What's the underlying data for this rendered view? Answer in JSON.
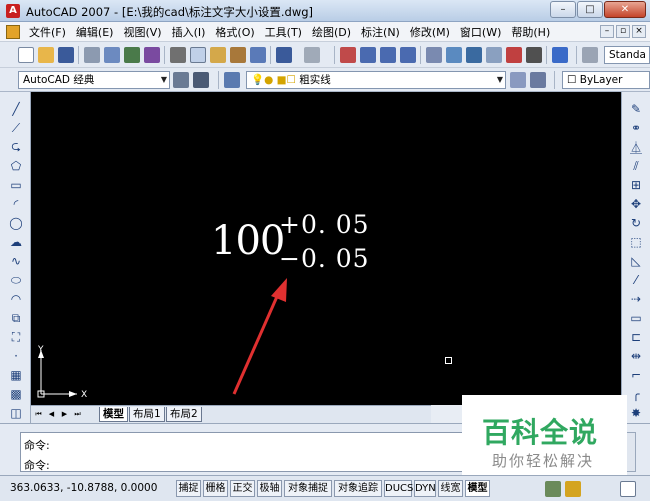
{
  "window": {
    "title": "AutoCAD 2007 - [E:\\我的cad\\标注文字大小设置.dwg]",
    "minimize_label": "–",
    "maximize_label": "□",
    "close_label": "✕"
  },
  "menu": {
    "items": [
      {
        "label": "文件(F)"
      },
      {
        "label": "编辑(E)"
      },
      {
        "label": "视图(V)"
      },
      {
        "label": "插入(I)"
      },
      {
        "label": "格式(O)"
      },
      {
        "label": "工具(T)"
      },
      {
        "label": "绘图(D)"
      },
      {
        "label": "标注(N)"
      },
      {
        "label": "修改(M)"
      },
      {
        "label": "窗口(W)"
      },
      {
        "label": "帮助(H)"
      }
    ]
  },
  "toolbar": {
    "text_style_value": "Standa",
    "workspace_value": "AutoCAD 经典",
    "layer_value": "粗实线",
    "color_value": "ByLayer"
  },
  "drawing": {
    "dimension_value": "100",
    "upper_tolerance": "+0. 05",
    "lower_tolerance": "−0. 05",
    "ucs_x": "X",
    "ucs_y": "Y"
  },
  "layout_tabs": [
    {
      "label": "模型",
      "active": true
    },
    {
      "label": "布局1",
      "active": false
    },
    {
      "label": "布局2",
      "active": false
    }
  ],
  "command": {
    "line1": "命令:",
    "line2": "命令:"
  },
  "status": {
    "coordinates": "363.0633, -10.8788, 0.0000",
    "buttons": [
      "捕捉",
      "栅格",
      "正交",
      "极轴",
      "对象捕捉",
      "对象追踪",
      "DUCS",
      "DYN",
      "线宽",
      "模型"
    ]
  },
  "watermark": {
    "title": "百科全说",
    "subtitle": "助你轻松解决"
  },
  "colors": {
    "canvas": "#000000",
    "arrow": "#e03030",
    "watermark_green": "#30a860"
  }
}
